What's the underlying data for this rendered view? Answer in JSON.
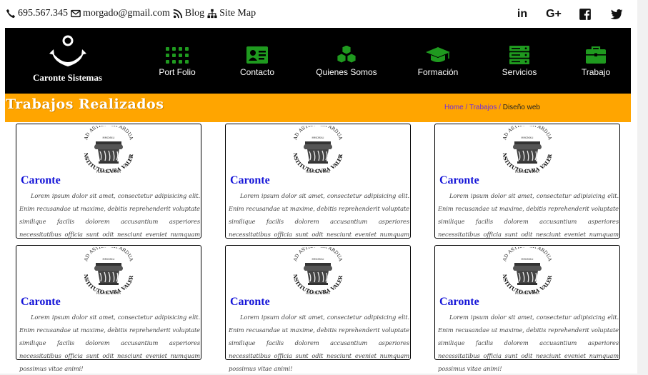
{
  "contact": {
    "phone": "695.567.345",
    "email": "morgado@gmail.com",
    "blog": "Blog",
    "sitemap": "Site Map"
  },
  "social": [
    {
      "icon": "linkedin-icon",
      "label": "in"
    },
    {
      "icon": "google-plus-icon",
      "label": "G+"
    },
    {
      "icon": "facebook-icon",
      "label": ""
    },
    {
      "icon": "twitter-icon",
      "label": ""
    }
  ],
  "brand": {
    "name": "Caronte Sistemas"
  },
  "nav": [
    {
      "label": "Port Folio",
      "icon": "grid-dots-icon"
    },
    {
      "label": "Contacto",
      "icon": "id-card-icon"
    },
    {
      "label": "Quienes Somos",
      "icon": "cubes-icon"
    },
    {
      "label": "Formación",
      "icon": "graduation-cap-icon"
    },
    {
      "label": "Servicios",
      "icon": "server-icon"
    },
    {
      "label": "Trabajo",
      "icon": "briefcase-icon"
    }
  ],
  "page": {
    "title": "Trabajos Realizados",
    "breadcrumb": {
      "home": "Home",
      "section": "Trabajos",
      "current": "Diseño web",
      "sep": " / "
    }
  },
  "emblem": {
    "motto": "AD ASTRA PER ARDUA",
    "sub": "MMCMXLI",
    "name": "INSTITUTO CVRA VALERA",
    "place": "HUERCAL-OVERA"
  },
  "cards": [
    {
      "title": "Caronte",
      "text": "Lorem ipsum dolor sit amet, consectetur adipisicing elit. Enim recusandae ut maxime, debitis reprehenderit voluptate similique facilis dolorem accusantium asperiores necessitatibus officia sunt odit nesciunt eveniet numquam possimus vitae animi!"
    },
    {
      "title": "Caronte",
      "text": "Lorem ipsum dolor sit amet, consectetur adipisicing elit. Enim recusandae ut maxime, debitis reprehenderit voluptate similique facilis dolorem accusantium asperiores necessitatibus officia sunt odit nesciunt eveniet numquam possimus vitae animi!"
    },
    {
      "title": "Caronte",
      "text": "Lorem ipsum dolor sit amet, consectetur adipisicing elit. Enim recusandae ut maxime, debitis reprehenderit voluptate similique facilis dolorem accusantium asperiores necessitatibus officia sunt odit nesciunt eveniet numquam possimus vitae animi!"
    },
    {
      "title": "Caronte",
      "text": "Lorem ipsum dolor sit amet, consectetur adipisicing elit. Enim recusandae ut maxime, debitis reprehenderit voluptate similique facilis dolorem accusantium asperiores necessitatibus officia sunt odit nesciunt eveniet numquam possimus vitae animi!"
    },
    {
      "title": "Caronte",
      "text": "Lorem ipsum dolor sit amet, consectetur adipisicing elit. Enim recusandae ut maxime, debitis reprehenderit voluptate similique facilis dolorem accusantium asperiores necessitatibus officia sunt odit nesciunt eveniet numquam possimus vitae animi!"
    },
    {
      "title": "Caronte",
      "text": "Lorem ipsum dolor sit amet, consectetur adipisicing elit. Enim recusandae ut maxime, debitis reprehenderit voluptate similique facilis dolorem accusantium asperiores necessitatibus officia sunt odit nesciunt eveniet numquam possimus vitae animi!"
    }
  ],
  "colors": {
    "nav_bg": "#000000",
    "banner": "#ffa500",
    "nav_icon": "#1f9a1f",
    "card_title": "#1515d8",
    "link": "#6f2ce0"
  }
}
